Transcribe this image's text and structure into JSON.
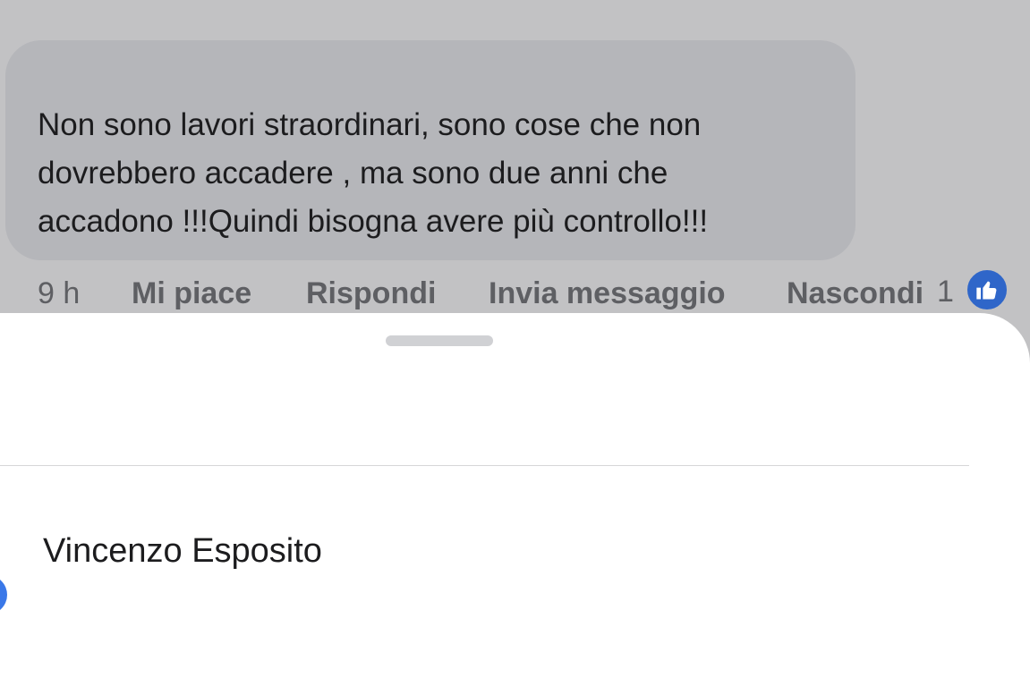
{
  "comment": {
    "text": "Non sono lavori straordinari, sono cose che non\ndovrebbero accadere , ma sono due anni che\naccadono !!!Quindi bisogna avere più controllo!!!",
    "time": "9 h",
    "like_label": "Mi piace",
    "reply_label": "Rispondi",
    "message_label": "Invia messaggio",
    "hide_label": "Nascondi",
    "reaction_count": "1",
    "reaction_icon": "thumbs-up-icon"
  },
  "sheet": {
    "user_name": "Vincenzo Esposito"
  },
  "colors": {
    "backdrop": "#c2c2c4",
    "bubble": "#b5b6ba",
    "action_text": "#5e5f63",
    "like_badge": "#2f66c9",
    "avatar": "#3a78e8"
  }
}
